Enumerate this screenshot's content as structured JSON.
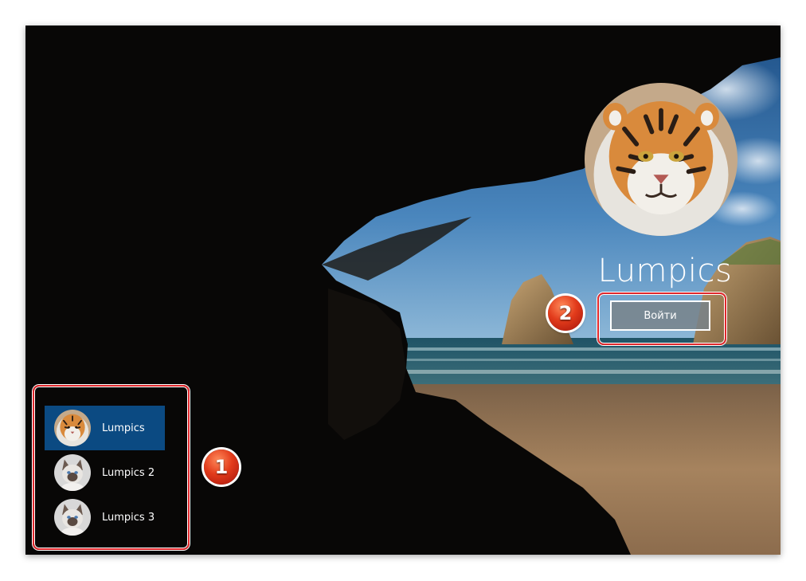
{
  "account": {
    "name": "Lumpics",
    "signin_label": "Войти",
    "avatar_icon": "tiger-avatar-icon"
  },
  "users": [
    {
      "label": "Lumpics",
      "avatar_icon": "tiger-avatar-icon",
      "selected": true
    },
    {
      "label": "Lumpics 2",
      "avatar_icon": "cat-avatar-icon",
      "selected": false
    },
    {
      "label": "Lumpics 3",
      "avatar_icon": "cat-avatar-icon",
      "selected": false
    }
  ],
  "annotations": {
    "badge_1": "1",
    "badge_2": "2",
    "frame_color": "#e0282c"
  },
  "colors": {
    "selected_user": "#0b4a82"
  }
}
